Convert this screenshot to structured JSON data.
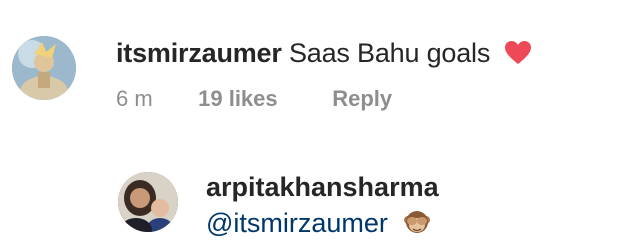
{
  "comment": {
    "username": "itsmirzaumer",
    "text": "Saas Bahu goals",
    "time": "6 m",
    "likes": "19 likes",
    "reply": "Reply",
    "emoji_icon": "red-heart-icon"
  },
  "reply_comment": {
    "username": "arpitakhansharma",
    "mention": "@itsmirzaumer",
    "emoji_icon": "see-no-evil-monkey-icon"
  },
  "colors": {
    "heart": "#ed4956",
    "mention": "#00376b",
    "meta": "#8e8e8e"
  }
}
